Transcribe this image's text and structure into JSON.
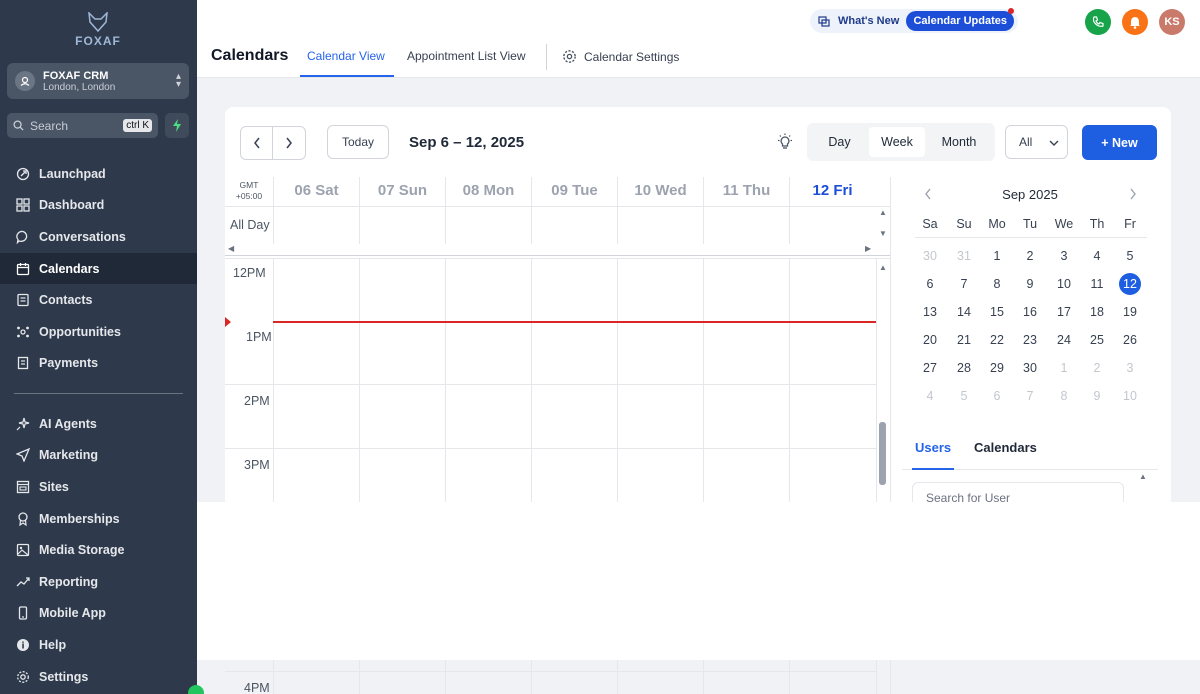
{
  "sidebar": {
    "brand": "FOXAF",
    "account": {
      "name": "FOXAF CRM",
      "location": "London, London"
    },
    "search": {
      "placeholder": "Search",
      "shortcut": "ctrl K"
    },
    "items": [
      {
        "label": "Launchpad",
        "icon": "rocket-icon"
      },
      {
        "label": "Dashboard",
        "icon": "grid-icon"
      },
      {
        "label": "Conversations",
        "icon": "chat-icon"
      },
      {
        "label": "Calendars",
        "icon": "calendar-icon",
        "active": true
      },
      {
        "label": "Contacts",
        "icon": "contacts-icon"
      },
      {
        "label": "Opportunities",
        "icon": "opportunities-icon"
      },
      {
        "label": "Payments",
        "icon": "payments-icon"
      }
    ],
    "items2": [
      {
        "label": "AI Agents",
        "icon": "sparkle-icon"
      },
      {
        "label": "Marketing",
        "icon": "send-icon"
      },
      {
        "label": "Sites",
        "icon": "sites-icon"
      },
      {
        "label": "Memberships",
        "icon": "badge-icon"
      },
      {
        "label": "Media Storage",
        "icon": "image-icon"
      },
      {
        "label": "Reporting",
        "icon": "trend-icon"
      },
      {
        "label": "Mobile App",
        "icon": "phone-icon"
      },
      {
        "label": "Help",
        "icon": "help-icon"
      },
      {
        "label": "Settings",
        "icon": "gear-icon"
      }
    ]
  },
  "topbar": {
    "whats_new": "What's New",
    "updates": "Calendar Updates",
    "avatar": "KS",
    "colors": {
      "phone": "#16a34a",
      "bell": "#f97316",
      "avatar": "#c97a6a"
    }
  },
  "header": {
    "title": "Calendars",
    "tabs": [
      "Calendar View",
      "Appointment List View",
      "Calendar Settings"
    ]
  },
  "toolbar": {
    "today": "Today",
    "range": "Sep 6 – 12, 2025",
    "views": [
      "Day",
      "Week",
      "Month"
    ],
    "filter": "All",
    "new": "+ New"
  },
  "calendar": {
    "timezone": [
      "GMT",
      "+05:00"
    ],
    "days": [
      "06 Sat",
      "07 Sun",
      "08 Mon",
      "09 Tue",
      "10 Wed",
      "11 Thu",
      "12 Fri"
    ],
    "all_day": "All Day",
    "times": [
      "12PM",
      "1PM",
      "2PM",
      "3PM",
      "4PM"
    ]
  },
  "mini_calendar": {
    "month": "Sep 2025",
    "dow": [
      "Sa",
      "Su",
      "Mo",
      "Tu",
      "We",
      "Th",
      "Fr"
    ],
    "weeks": [
      [
        "30",
        "31",
        "1",
        "2",
        "3",
        "4",
        "5"
      ],
      [
        "6",
        "7",
        "8",
        "9",
        "10",
        "11",
        "12"
      ],
      [
        "13",
        "14",
        "15",
        "16",
        "17",
        "18",
        "19"
      ],
      [
        "20",
        "21",
        "22",
        "23",
        "24",
        "25",
        "26"
      ],
      [
        "27",
        "28",
        "29",
        "30",
        "1",
        "2",
        "3"
      ],
      [
        "4",
        "5",
        "6",
        "7",
        "8",
        "9",
        "10"
      ]
    ],
    "selected": "12"
  },
  "right_tabs": [
    "Users",
    "Calendars"
  ],
  "user_search_placeholder": "Search for User"
}
